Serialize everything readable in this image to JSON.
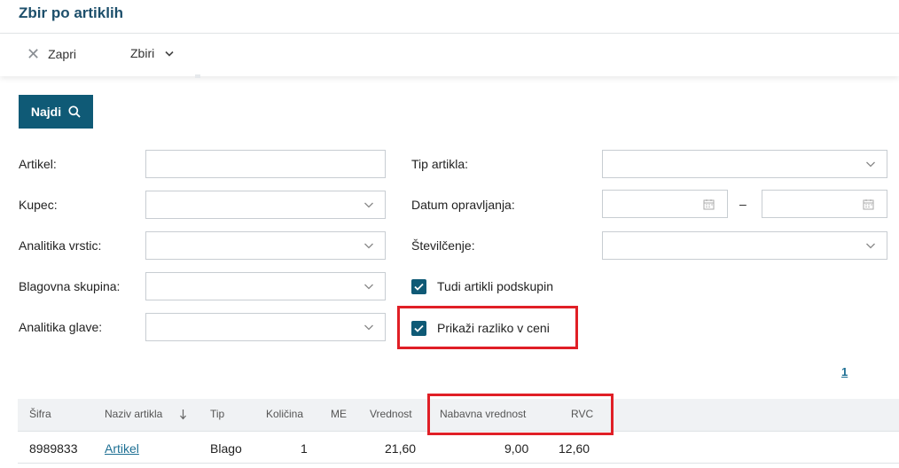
{
  "page": {
    "title": "Zbir po artiklih"
  },
  "toolbar": {
    "close_label": "Zapri",
    "summary_label": "Zbiri"
  },
  "search": {
    "find_label": "Najdi"
  },
  "filters": {
    "artikel": {
      "label": "Artikel:",
      "value": ""
    },
    "kupec": {
      "label": "Kupec:",
      "value": ""
    },
    "analitika_vrstic": {
      "label": "Analitika vrstic:",
      "value": ""
    },
    "blagovna_skupina": {
      "label": "Blagovna skupina:",
      "value": ""
    },
    "analitika_glave": {
      "label": "Analitika glave:",
      "value": ""
    },
    "tip_artikla": {
      "label": "Tip artikla:",
      "value": ""
    },
    "datum_opravljanja": {
      "label": "Datum opravljanja:",
      "from": "",
      "to": "",
      "separator": "–"
    },
    "stevilcenje": {
      "label": "Številčenje:",
      "value": ""
    },
    "podskupine": {
      "label": "Tudi artikli podskupin",
      "checked": true
    },
    "razlika_v_ceni": {
      "label": "Prikaži razliko v ceni",
      "checked": true
    }
  },
  "pagination": {
    "current": "1"
  },
  "table": {
    "columns": [
      "Šifra",
      "Naziv artikla",
      "Tip",
      "Količina",
      "ME",
      "Vrednost",
      "Nabavna vrednost",
      "RVC"
    ],
    "sort_icon": "arrow-down-icon",
    "rows": [
      {
        "sifra": "8989833",
        "naziv": "Artikel",
        "tip": "Blago",
        "kolicina": "1",
        "me": "",
        "vrednost": "21,60",
        "nabavna_vrednost": "9,00",
        "rvc": "12,60"
      }
    ]
  },
  "colors": {
    "accent": "#0f5a76",
    "highlight": "#e01f26",
    "link": "#1d6f93"
  }
}
